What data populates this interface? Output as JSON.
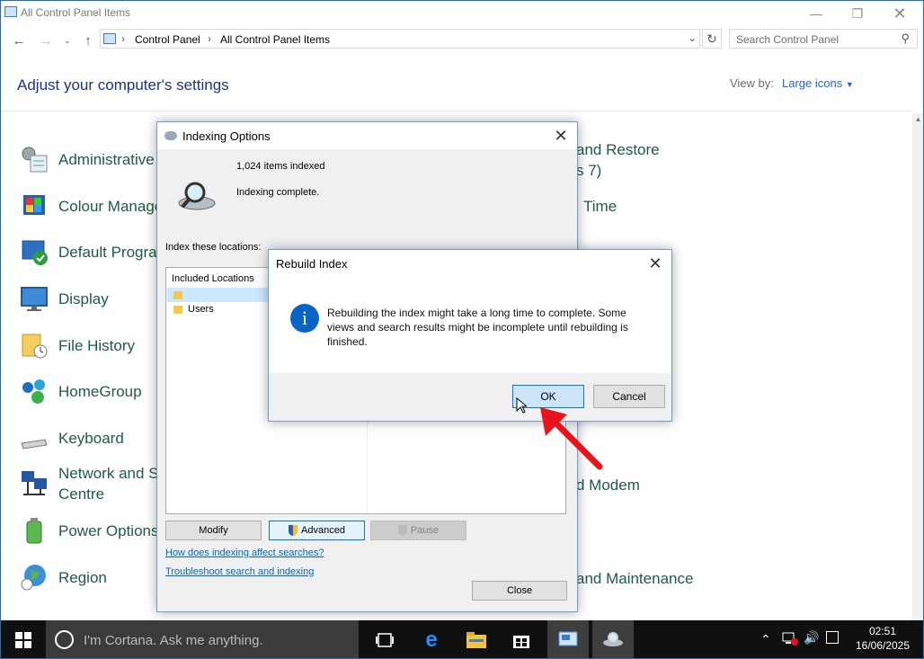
{
  "window": {
    "title": "All Control Panel Items"
  },
  "address": {
    "crumbs": [
      "Control Panel",
      "All Control Panel Items"
    ],
    "search_placeholder": "Search Control Panel"
  },
  "header": {
    "title": "Adjust your computer's settings",
    "view_by_label": "View by:",
    "view_by_value": "Large icons"
  },
  "items_left": [
    {
      "label": "Administrative",
      "icon": "admin-tools-icon"
    },
    {
      "label": "Colour Manage",
      "icon": "colour-management-icon"
    },
    {
      "label": "Default Progra",
      "icon": "default-programs-icon"
    },
    {
      "label": "Display",
      "icon": "display-icon"
    },
    {
      "label": "File History",
      "icon": "file-history-icon"
    },
    {
      "label": "HomeGroup",
      "icon": "homegroup-icon"
    },
    {
      "label": "Keyboard",
      "icon": "keyboard-icon"
    },
    {
      "label": "Network and S",
      "label2": "Centre",
      "icon": "network-icon"
    },
    {
      "label": "Power Options",
      "icon": "power-options-icon"
    },
    {
      "label": "Region",
      "icon": "region-icon"
    }
  ],
  "items_right": [
    {
      "label": "and Restore",
      "label2": "s 7)"
    },
    {
      "label": "Time"
    },
    {
      "label": "d Modem"
    },
    {
      "label": "and Maintenance"
    }
  ],
  "indexing": {
    "title": "Indexing Options",
    "count": "1,024 items indexed",
    "status": "Indexing complete.",
    "locations_label": "Index these locations:",
    "col_header": "Included Locations",
    "rows": [
      "Users"
    ],
    "modify": "Modify",
    "advanced": "Advanced",
    "pause": "Pause",
    "link1": "How does indexing affect searches?",
    "link2": "Troubleshoot search and indexing",
    "close": "Close"
  },
  "rebuild": {
    "title": "Rebuild Index",
    "message": "Rebuilding the index might take a long time to complete. Some views and search results might be incomplete until rebuilding is finished.",
    "ok": "OK",
    "cancel": "Cancel"
  },
  "taskbar": {
    "cortana": "I'm Cortana. Ask me anything.",
    "time": "02:51",
    "date": "16/06/2025"
  },
  "colors": {
    "accent": "#0078d7",
    "arrow": "#e8141b",
    "taskbar": "#101010"
  }
}
